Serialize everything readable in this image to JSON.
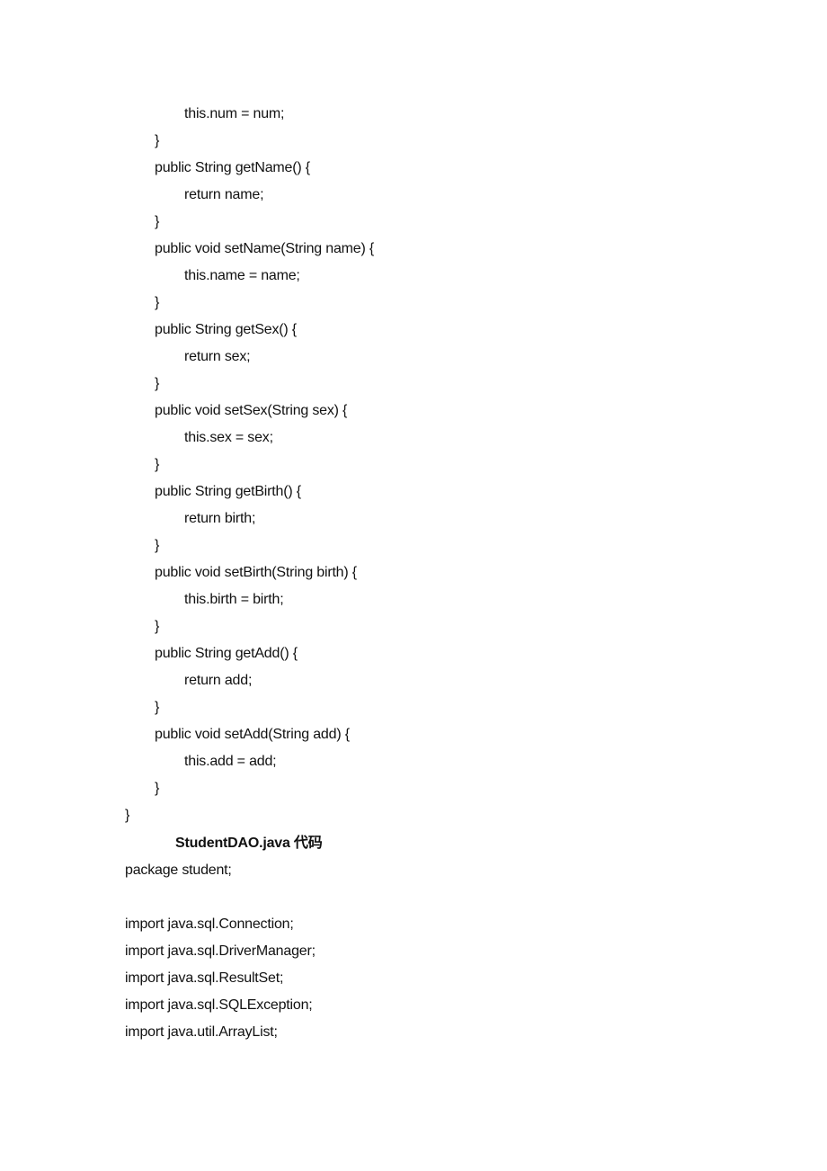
{
  "document": {
    "lines": [
      {
        "indent": 2,
        "text": "this.num = num;"
      },
      {
        "indent": 1,
        "text": "}"
      },
      {
        "indent": 1,
        "text": "public String getName() {"
      },
      {
        "indent": 2,
        "text": "return name;"
      },
      {
        "indent": 1,
        "text": "}"
      },
      {
        "indent": 1,
        "text": "public void setName(String name) {"
      },
      {
        "indent": 2,
        "text": "this.name = name;"
      },
      {
        "indent": 1,
        "text": "}"
      },
      {
        "indent": 1,
        "text": "public String getSex() {"
      },
      {
        "indent": 2,
        "text": "return sex;"
      },
      {
        "indent": 1,
        "text": "}"
      },
      {
        "indent": 1,
        "text": "public void setSex(String sex) {"
      },
      {
        "indent": 2,
        "text": "this.sex = sex;"
      },
      {
        "indent": 1,
        "text": "}"
      },
      {
        "indent": 1,
        "text": "public String getBirth() {"
      },
      {
        "indent": 2,
        "text": "return birth;"
      },
      {
        "indent": 1,
        "text": "}"
      },
      {
        "indent": 1,
        "text": "public void setBirth(String birth) {"
      },
      {
        "indent": 2,
        "text": "this.birth = birth;"
      },
      {
        "indent": 1,
        "text": "}"
      },
      {
        "indent": 1,
        "text": "public String getAdd() {"
      },
      {
        "indent": 2,
        "text": "return add;"
      },
      {
        "indent": 1,
        "text": "}"
      },
      {
        "indent": 1,
        "text": "public void setAdd(String add) {"
      },
      {
        "indent": 2,
        "text": "this.add = add;"
      },
      {
        "indent": 1,
        "text": "}"
      },
      {
        "indent": 0,
        "text": "}"
      }
    ],
    "section_heading": "StudentDAO.java 代码",
    "code_after": [
      "package student;",
      "",
      "import java.sql.Connection;",
      "import java.sql.DriverManager;",
      "import java.sql.ResultSet;",
      "import java.sql.SQLException;",
      "import java.util.ArrayList;"
    ]
  }
}
